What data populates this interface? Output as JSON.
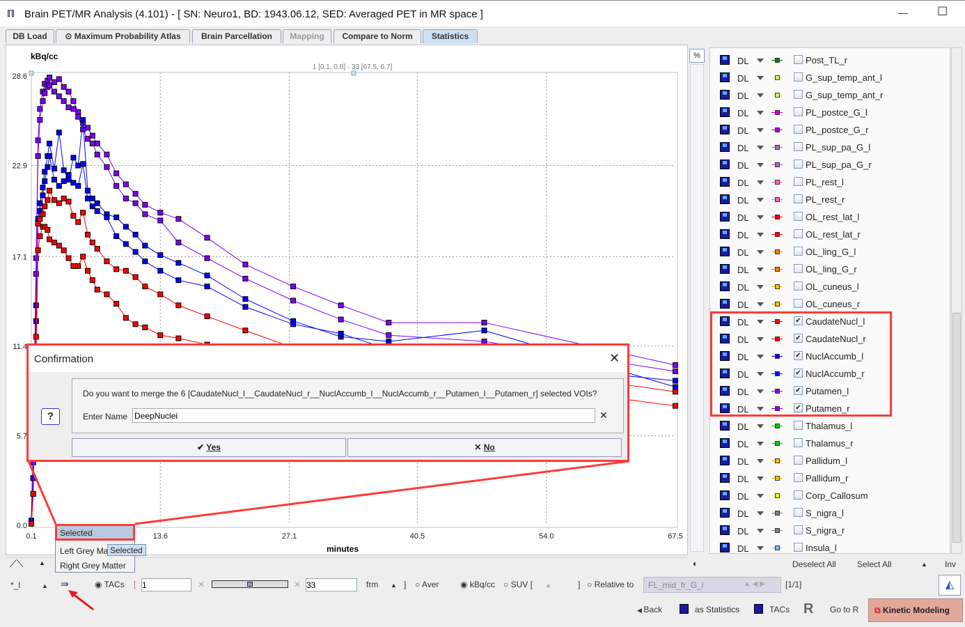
{
  "window": {
    "title": "Brain PET/MR Analysis (4.101) - [ SN: Neuro1, BD: 1943.06.12, SED: Averaged PET in MR space ]",
    "minimize": "—",
    "maximize": "☐"
  },
  "tabs": [
    {
      "label": "DB Load"
    },
    {
      "label": "Maximum Probability Atlas"
    },
    {
      "label": "Brain Parcellation"
    },
    {
      "label": "Mapping"
    },
    {
      "label": "Compare to Norm"
    },
    {
      "label": "Statistics"
    }
  ],
  "chart_data": {
    "type": "line",
    "ylabel": "kBq/cc",
    "xlabel": "minutes",
    "annotation": "1 [0.1, 0.8] - 33 [67.5, 6.7]",
    "xlim": [
      0.1,
      67.5
    ],
    "ylim": [
      0.0,
      28.6
    ],
    "grid": true,
    "xticks": [
      "0.1",
      "13.6",
      "27.1",
      "40.5",
      "54.0",
      "67.5"
    ],
    "yticks": [
      "0.0",
      "5.7",
      "11.4",
      "17.1",
      "22.9",
      "28.6"
    ],
    "x": [
      0.1,
      0.3,
      0.6,
      0.8,
      1.0,
      1.3,
      1.5,
      1.8,
      2.0,
      2.5,
      3.0,
      3.5,
      4.0,
      4.5,
      5.0,
      5.5,
      6.0,
      6.5,
      7.0,
      8.0,
      9.0,
      10,
      11,
      12,
      13.6,
      15.5,
      18.5,
      22.5,
      27.5,
      32.5,
      37.5,
      47.5,
      67.5
    ],
    "series": [
      {
        "color": "#8000ff",
        "values": [
          0.3,
          5,
          17,
          24.5,
          26.5,
          27.6,
          28.1,
          28.3,
          28.5,
          28.2,
          28.4,
          27.9,
          27.6,
          27.0,
          26.3,
          25.6,
          25.3,
          24.8,
          24.3,
          23.6,
          22.4,
          21.7,
          21.1,
          20.4,
          19.9,
          19.5,
          18.3,
          16.6,
          15.2,
          14.0,
          12.9,
          12.9,
          10.2
        ]
      },
      {
        "color": "#8000ff",
        "values": [
          0.2,
          4,
          16,
          23.5,
          25.8,
          27.0,
          27.5,
          27.9,
          28.0,
          27.6,
          27.3,
          27.0,
          26.6,
          26.5,
          26.0,
          25.2,
          24.6,
          24.3,
          23.6,
          22.8,
          21.6,
          20.8,
          20.5,
          19.8,
          19.4,
          18.0,
          17.0,
          15.7,
          14.3,
          13.1,
          12.1,
          11.7,
          9.8
        ]
      },
      {
        "color": "#0000ff",
        "values": [
          0.3,
          3,
          14,
          19.5,
          20.5,
          21.5,
          22.5,
          23.5,
          24.3,
          22.7,
          25.0,
          22.6,
          22.0,
          23.4,
          22.9,
          25.8,
          21.3,
          20.8,
          20.5,
          19.8,
          19.6,
          19.0,
          18.5,
          17.8,
          17.2,
          16.7,
          15.9,
          14.4,
          13.0,
          12.0,
          11.7,
          12.4,
          8.8
        ]
      },
      {
        "color": "#0000ff",
        "values": [
          0.2,
          3,
          13,
          19.2,
          20.0,
          21.0,
          21.9,
          22.8,
          23.5,
          22.0,
          21.6,
          21.9,
          22.3,
          21.8,
          21.6,
          23.0,
          20.8,
          20.3,
          20.0,
          19.6,
          18.4,
          17.9,
          17.4,
          16.8,
          16.2,
          15.6,
          15.2,
          13.9,
          12.8,
          12.2,
          11.2,
          10.4,
          9.2
        ]
      },
      {
        "color": "#ff0000",
        "values": [
          0.1,
          2,
          12,
          19.2,
          19.5,
          19.8,
          20.3,
          20.7,
          21.3,
          20.7,
          20.5,
          20.8,
          20.6,
          19.7,
          19.3,
          19.9,
          18.5,
          18.0,
          17.6,
          16.8,
          16.3,
          16.2,
          15.8,
          15.2,
          14.7,
          14.0,
          13.3,
          12.4,
          11.3,
          10.9,
          10.8,
          10.2,
          8.5
        ]
      },
      {
        "color": "#ff0000",
        "values": [
          0.1,
          2,
          11,
          17.5,
          18.4,
          19.0,
          19.0,
          18.8,
          18.2,
          18.0,
          17.8,
          17.5,
          17.0,
          16.5,
          16.5,
          17.1,
          16.2,
          15.6,
          15.0,
          14.7,
          14.1,
          13.2,
          12.8,
          12.6,
          12.1,
          11.9,
          11.5,
          10.8,
          10.4,
          10.0,
          9.6,
          9.2,
          7.6
        ]
      }
    ]
  },
  "chart_toolbar": {
    "percent": "%"
  },
  "voi_list": [
    {
      "fmt": "DL",
      "name": "Post_TL_r",
      "color": "#008000",
      "checked": false
    },
    {
      "fmt": "DL",
      "name": "G_sup_temp_ant_l",
      "color": "#ccff66",
      "checked": false
    },
    {
      "fmt": "DL",
      "name": "G_sup_temp_ant_r",
      "color": "#ccff66",
      "checked": false
    },
    {
      "fmt": "DL",
      "name": "PL_postce_G_l",
      "color": "#cc00cc",
      "checked": false
    },
    {
      "fmt": "DL",
      "name": "PL_postce_G_r",
      "color": "#b300e6",
      "checked": false
    },
    {
      "fmt": "DL",
      "name": "PL_sup_pa_G_l",
      "color": "#b366b3",
      "checked": false
    },
    {
      "fmt": "DL",
      "name": "PL_sup_pa_G_r",
      "color": "#b366b3",
      "checked": false
    },
    {
      "fmt": "DL",
      "name": "PL_rest_l",
      "color": "#ff66b3",
      "checked": false
    },
    {
      "fmt": "DL",
      "name": "PL_rest_r",
      "color": "#ff66b3",
      "checked": false
    },
    {
      "fmt": "DL",
      "name": "OL_rest_lat_l",
      "color": "#ff0000",
      "checked": false
    },
    {
      "fmt": "DL",
      "name": "OL_rest_lat_r",
      "color": "#ff0000",
      "checked": false
    },
    {
      "fmt": "DL",
      "name": "OL_ling_G_l",
      "color": "#ff8000",
      "checked": false
    },
    {
      "fmt": "DL",
      "name": "OL_ling_G_r",
      "color": "#ff8000",
      "checked": false
    },
    {
      "fmt": "DL",
      "name": "OL_cuneus_l",
      "color": "#ffbf00",
      "checked": false
    },
    {
      "fmt": "DL",
      "name": "OL_cuneus_r",
      "color": "#ffbf00",
      "checked": false
    },
    {
      "fmt": "DL",
      "name": "CaudateNucl_l",
      "color": "#ff0000",
      "checked": true
    },
    {
      "fmt": "DL",
      "name": "CaudateNucl_r",
      "color": "#ff0000",
      "checked": true
    },
    {
      "fmt": "DL",
      "name": "NuclAccumb_l",
      "color": "#0000ff",
      "checked": true
    },
    {
      "fmt": "DL",
      "name": "NuclAccumb_r",
      "color": "#0000ff",
      "checked": true
    },
    {
      "fmt": "DL",
      "name": "Putamen_l",
      "color": "#8000ff",
      "checked": true
    },
    {
      "fmt": "DL",
      "name": "Putamen_r",
      "color": "#8000ff",
      "checked": true
    },
    {
      "fmt": "DL",
      "name": "Thalamus_l",
      "color": "#00cc00",
      "checked": false
    },
    {
      "fmt": "DL",
      "name": "Thalamus_r",
      "color": "#00cc00",
      "checked": false
    },
    {
      "fmt": "DL",
      "name": "Pallidum_l",
      "color": "#ffbf00",
      "checked": false
    },
    {
      "fmt": "DL",
      "name": "Pallidum_r",
      "color": "#ffbf00",
      "checked": false
    },
    {
      "fmt": "DL",
      "name": "Corp_Callosum",
      "color": "#ffff00",
      "checked": false
    },
    {
      "fmt": "DL",
      "name": "S_nigra_l",
      "color": "#808080",
      "checked": false
    },
    {
      "fmt": "DL",
      "name": "S_nigra_r",
      "color": "#808080",
      "checked": false
    },
    {
      "fmt": "DL",
      "name": "Insula_l",
      "color": "#80b3ff",
      "checked": false
    }
  ],
  "list_controls": {
    "deselect_all": "Deselect All",
    "select_all": "Select All",
    "inv": "Inv"
  },
  "dropdown": {
    "selected": "Selected",
    "items": [
      "Left Grey Ma",
      "Right Grey Matter"
    ],
    "tooltip": "Selected"
  },
  "controls": {
    "star": "*_l",
    "tacs": "TACs",
    "from": "1",
    "to": "33",
    "frm": "frm",
    "aver": "Aver",
    "kbq": "kBq/cc",
    "suv": "SUV [",
    "relative": "Relative to",
    "relative_value": "FL_mid_fr_G_l",
    "page": "[1/1]",
    "bracket_open": "[",
    "bracket_close": "]"
  },
  "actions": {
    "back": "Back",
    "as_statistics": "as Statistics",
    "tacs": "TACs",
    "go_to_r": "Go to R",
    "kinetic_modeling": "Kinetic Modeling"
  },
  "dialog": {
    "title": "Confirmation",
    "message": "Do you want to merge the 6 [CaudateNucl_l__CaudateNucl_r__NuclAccumb_l__NuclAccumb_r__Putamen_l__Putamen_r] selected VOIs?",
    "name_label": "Enter Name",
    "name_value": "DeepNuclei",
    "yes": "Yes",
    "no": "No",
    "close": "✕",
    "clear": "✕",
    "help": "?"
  },
  "annotation_color": "#ff3a3a"
}
